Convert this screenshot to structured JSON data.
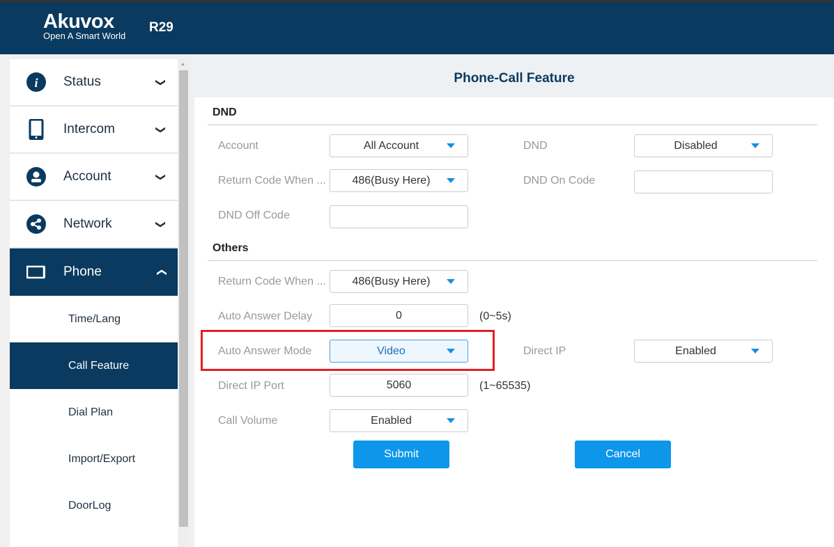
{
  "header": {
    "brand": "Akuvox",
    "slogan": "Open A Smart World",
    "model": "R29"
  },
  "sidebar": {
    "items": [
      {
        "label": "Status",
        "icon": "info-icon"
      },
      {
        "label": "Intercom",
        "icon": "tablet-icon"
      },
      {
        "label": "Account",
        "icon": "user-icon"
      },
      {
        "label": "Network",
        "icon": "share-icon"
      },
      {
        "label": "Phone",
        "icon": "phone-screen-icon"
      }
    ],
    "sub_items": [
      "Time/Lang",
      "Call Feature",
      "Dial Plan",
      "Import/Export",
      "DoorLog"
    ]
  },
  "page": {
    "title": "Phone-Call Feature",
    "dnd": {
      "heading": "DND",
      "account_label": "Account",
      "account_value": "All Account",
      "dnd_label": "DND",
      "dnd_value": "Disabled",
      "return_code_label": "Return Code When ...",
      "return_code_value": "486(Busy Here)",
      "dnd_on_label": "DND On Code",
      "dnd_on_value": "",
      "dnd_off_label": "DND Off Code",
      "dnd_off_value": ""
    },
    "others": {
      "heading": "Others",
      "return_code_label": "Return Code When ...",
      "return_code_value": "486(Busy Here)",
      "delay_label": "Auto Answer Delay",
      "delay_value": "0",
      "delay_hint": "(0~5s)",
      "mode_label": "Auto Answer Mode",
      "mode_value": "Video",
      "direct_ip_label": "Direct IP",
      "direct_ip_value": "Enabled",
      "port_label": "Direct IP Port",
      "port_value": "5060",
      "port_hint": "(1~65535)",
      "volume_label": "Call Volume",
      "volume_value": "Enabled"
    },
    "submit": "Submit",
    "cancel": "Cancel"
  },
  "colors": {
    "navy": "#0a3a5f",
    "button": "#0d96ea",
    "highlight": "#e31e24"
  }
}
